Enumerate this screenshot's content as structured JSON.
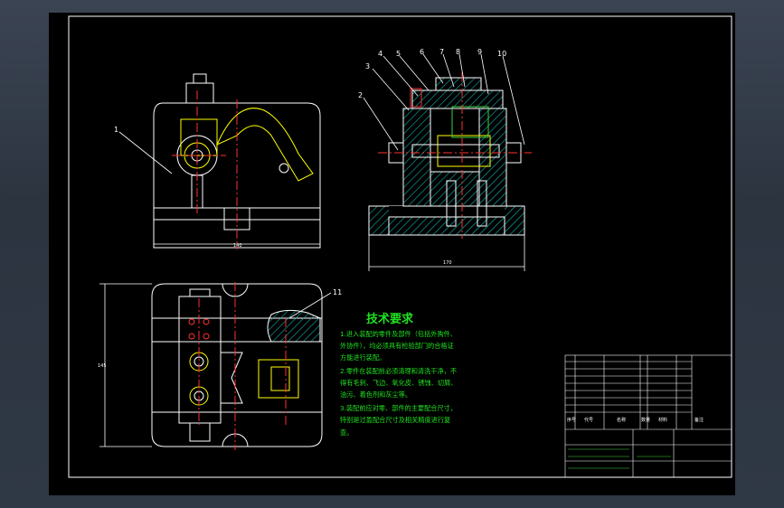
{
  "drawing": {
    "part_numbers": [
      "1",
      "2",
      "3",
      "4",
      "5",
      "6",
      "7",
      "8",
      "9",
      "10",
      "11"
    ],
    "dimensions": {
      "front_width": "140",
      "top_width": "170",
      "plan_height": "145"
    }
  },
  "tech_requirements": {
    "title": "技术要求",
    "lines": [
      "1.进入装配的零件及部件（包括外购件、",
      "外协件），均必须具有检验部门的合格证",
      "方能进行装配。",
      "2.零件在装配前必须清理和清洗干净，不",
      "得有毛刺、飞边、氧化皮、锈蚀、切屑、",
      "油污、着色剂和灰尘等。",
      "3.装配前应对零、部件的主要配合尺寸，",
      "特别是过盈配合尺寸及相关精度进行复",
      "查。"
    ]
  },
  "title_block": {
    "headers": [
      "序号",
      "代号",
      "名称",
      "数量",
      "材料",
      "备注"
    ]
  },
  "colors": {
    "background": "#000000",
    "frame": "#ffffff",
    "outline": "#ffffff",
    "center_line": "#ff3030",
    "yellow": "#ffff00",
    "hatch": "#14b4b4",
    "green": "#3fd23f",
    "text": "#20e020"
  }
}
